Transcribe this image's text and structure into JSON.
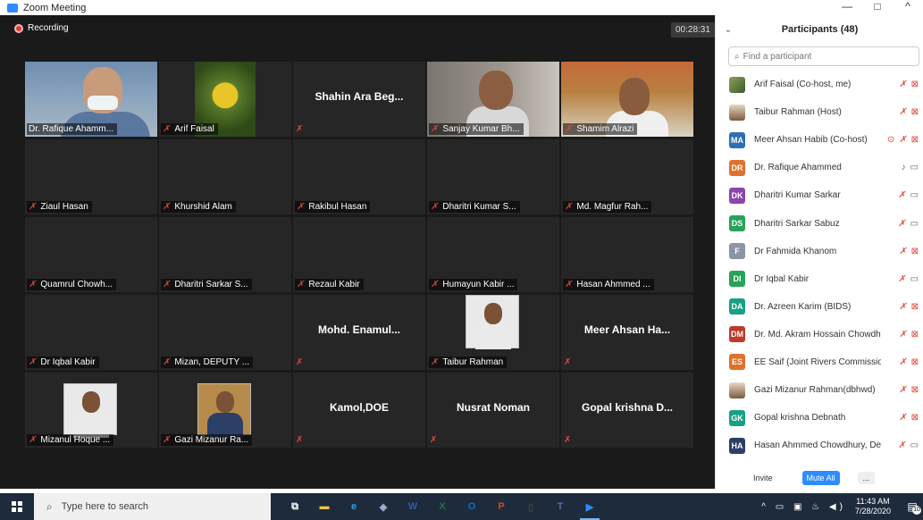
{
  "window": {
    "title": "Zoom Meeting",
    "controls": [
      "—",
      "□",
      "^"
    ]
  },
  "meeting": {
    "recording_label": "Recording",
    "timer": "00:28:31",
    "tiles": [
      {
        "name": "Dr. Rafique Ahamm...",
        "video": "v1",
        "active": true,
        "muted": false,
        "big": ""
      },
      {
        "name": "Arif Faisal",
        "video": "v2",
        "muted": true,
        "big": ""
      },
      {
        "name": "",
        "big": "Shahin Ara Beg...",
        "muted": true
      },
      {
        "name": "Sanjay Kumar Bh...",
        "video": "v3",
        "muted": true,
        "big": ""
      },
      {
        "name": "Shamim Alrazi",
        "video": "v4",
        "muted": true,
        "big": ""
      },
      {
        "name": "Ziaul Hasan",
        "muted": true,
        "big": ""
      },
      {
        "name": "Khurshid Alam",
        "muted": true,
        "big": ""
      },
      {
        "name": "Rakibul Hasan",
        "muted": true,
        "big": ""
      },
      {
        "name": "Dharitri Kumar S...",
        "muted": true,
        "big": ""
      },
      {
        "name": "Md. Magfur Rah...",
        "muted": true,
        "big": ""
      },
      {
        "name": "Quamrul Chowh...",
        "muted": true,
        "big": ""
      },
      {
        "name": "Dharitri Sarkar S...",
        "muted": true,
        "big": ""
      },
      {
        "name": "Rezaul Kabir",
        "muted": true,
        "big": ""
      },
      {
        "name": "Humayun Kabir ...",
        "muted": true,
        "big": ""
      },
      {
        "name": "Hasan Ahmmed ...",
        "muted": true,
        "big": ""
      },
      {
        "name": "Dr Iqbal Kabir",
        "muted": true,
        "big": ""
      },
      {
        "name": "Mizan, DEPUTY ...",
        "muted": true,
        "big": ""
      },
      {
        "name": "",
        "big": "Mohd. Enamul...",
        "muted": true
      },
      {
        "name": "Taibur Rahman",
        "photo": "light",
        "muted": true,
        "big": ""
      },
      {
        "name": "",
        "big": "Meer Ahsan Ha...",
        "muted": true
      },
      {
        "name": "Mizanul Hoque ...",
        "photo": "light",
        "muted": true,
        "big": ""
      },
      {
        "name": "Gazi Mizanur Ra...",
        "photo": "dark",
        "muted": true,
        "big": ""
      },
      {
        "name": "",
        "big": "Kamol,DOE",
        "muted": true
      },
      {
        "name": "",
        "big": "Nusrat Noman",
        "muted": true
      },
      {
        "name": "",
        "big": "Gopal krishna D...",
        "muted": true
      }
    ]
  },
  "participants": {
    "title": "Participants (48)",
    "search_placeholder": "Find a participant",
    "list": [
      {
        "initials": "",
        "avatar": "img",
        "color": "",
        "name": "Arif Faisal (Co-host, me)",
        "mic": "off",
        "video": "off",
        "rec": false
      },
      {
        "initials": "",
        "avatar": "img2",
        "color": "",
        "name": "Taibur Rahman (Host)",
        "mic": "off",
        "video": "off",
        "rec": false
      },
      {
        "initials": "MA",
        "avatar": "",
        "color": "#2d6fb7",
        "name": "Meer Ahsan Habib (Co-host)",
        "mic": "off",
        "video": "off",
        "rec": true
      },
      {
        "initials": "DR",
        "avatar": "",
        "color": "#e0702a",
        "name": "Dr. Rafique Ahammed",
        "mic": "on",
        "video": "on",
        "rec": false
      },
      {
        "initials": "DK",
        "avatar": "",
        "color": "#8e44ad",
        "name": "Dharitri Kumar Sarkar",
        "mic": "off",
        "video": "on",
        "rec": false
      },
      {
        "initials": "DS",
        "avatar": "",
        "color": "#27a35a",
        "name": "Dharitri Sarkar Sabuz",
        "mic": "off",
        "video": "on",
        "rec": false
      },
      {
        "initials": "F",
        "avatar": "",
        "color": "#8a96a3",
        "name": "Dr Fahmida Khanom",
        "mic": "off",
        "video": "off",
        "rec": false
      },
      {
        "initials": "DI",
        "avatar": "",
        "color": "#27a35a",
        "name": "Dr Iqbal Kabir",
        "mic": "off",
        "video": "on",
        "rec": false
      },
      {
        "initials": "DA",
        "avatar": "",
        "color": "#16a085",
        "name": "Dr. Azreen Karim (BIDS)",
        "mic": "off",
        "video": "off",
        "rec": false
      },
      {
        "initials": "DM",
        "avatar": "",
        "color": "#c0392b",
        "name": "Dr. Md. Akram Hossain Chowdh...",
        "mic": "off",
        "video": "off",
        "rec": false
      },
      {
        "initials": "ES",
        "avatar": "",
        "color": "#e0702a",
        "name": "EE Saif (Joint Rivers Commission)",
        "mic": "off",
        "video": "off",
        "rec": false
      },
      {
        "initials": "",
        "avatar": "img2",
        "color": "",
        "name": "Gazi Mizanur Rahman(dbhwd)",
        "mic": "off",
        "video": "off",
        "rec": false
      },
      {
        "initials": "GK",
        "avatar": "",
        "color": "#16a085",
        "name": "Gopal krishna Debnath",
        "mic": "off",
        "video": "off",
        "rec": false
      },
      {
        "initials": "HA",
        "avatar": "",
        "color": "#2c3e66",
        "name": "Hasan Ahmmed Chowdhury, De...",
        "mic": "off",
        "video": "on",
        "rec": false
      }
    ],
    "invite_label": "Invite",
    "mute_all_label": "Mute All",
    "more_label": "..."
  },
  "taskbar": {
    "search_placeholder": "Type here to search",
    "apps": [
      {
        "label": "⧉",
        "color": "#fff",
        "name": "task-view-icon"
      },
      {
        "label": "▬",
        "color": "#f3c242",
        "name": "file-explorer-icon"
      },
      {
        "label": "e",
        "color": "#3b9be0",
        "name": "edge-icon"
      },
      {
        "label": "◈",
        "color": "#9fb4d9",
        "name": "photos-icon"
      },
      {
        "label": "W",
        "color": "#2b5caa",
        "name": "word-icon"
      },
      {
        "label": "X",
        "color": "#1f7244",
        "name": "excel-icon"
      },
      {
        "label": "O",
        "color": "#0f6cbd",
        "name": "outlook-icon"
      },
      {
        "label": "P",
        "color": "#d24726",
        "name": "powerpoint-icon"
      },
      {
        "label": "▯",
        "color": "#444",
        "name": "blank-app-icon"
      },
      {
        "label": "T",
        "color": "#6264a7",
        "name": "teams-icon"
      },
      {
        "label": "▶",
        "color": "#2d8cff",
        "name": "zoom-icon",
        "active": true
      }
    ],
    "time": "11:43 AM",
    "date": "7/28/2020",
    "notif_count": "10"
  }
}
